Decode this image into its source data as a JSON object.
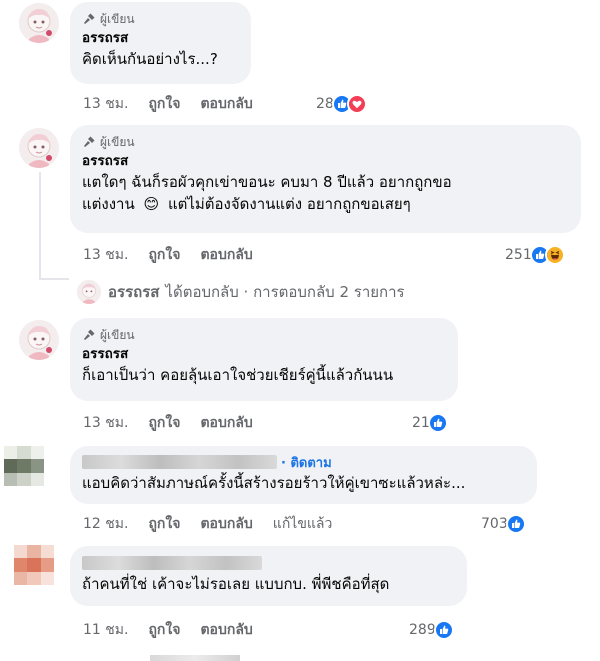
{
  "comments": [
    {
      "badge": "ผู้เขียน",
      "author": "อรรถรส",
      "lines": [
        "คิดเห็นกันอย่างไร...?"
      ],
      "time": "13 ชม.",
      "like": "ถูกใจ",
      "reply": "ตอบกลับ",
      "reaction_count": "28",
      "reactions": [
        "like",
        "love"
      ]
    },
    {
      "badge": "ผู้เขียน",
      "author": "อรรถรส",
      "lines": [
        "แตใดๆ ฉันก็รอผัวคุกเข่าขอนะ คบมา 8 ปีแล้ว อยากถูกขอ",
        "แต่งงาน",
        "แต่ไม่ต้องจัดงานแต่ง อยากถูกขอเสยๆ"
      ],
      "emoji": "😊",
      "time": "13 ชม.",
      "like": "ถูกใจ",
      "reply": "ตอบกลับ",
      "reaction_count": "251",
      "reactions": [
        "like",
        "haha"
      ]
    },
    {
      "badge": "ผู้เขียน",
      "author": "อรรถรส",
      "lines": [
        "ก็เอาเป็นว่า คอยลุ้นเอาใจช่วยเชียร์คู่นี้แล้วกันนน"
      ],
      "time": "13 ชม.",
      "like": "ถูกใจ",
      "reply": "ตอบกลับ",
      "reaction_count": "21",
      "reactions": [
        "like"
      ]
    },
    {
      "follow": "· ติดตาม",
      "lines": [
        "แอบคิดว่าสัมภาษณ์ครั้งนี้สร้างรอยร้าวให้คู่เขาซะแล้วหล่ะ..."
      ],
      "time": "12 ชม.",
      "like": "ถูกใจ",
      "reply": "ตอบกลับ",
      "edited": "แก้ไขแล้ว",
      "reaction_count": "703",
      "reactions": [
        "like"
      ]
    },
    {
      "lines": [
        "ถ้าคนที่ใช่ เค้าจะไม่รอเลย แบบกบ. พี่พีชคือที่สุด"
      ],
      "time": "11 ชม.",
      "like": "ถูกใจ",
      "reply": "ตอบกลับ",
      "reaction_count": "289",
      "reactions": [
        "like"
      ]
    }
  ],
  "reply_summary": {
    "author": "อรรถรส",
    "text": "ได้ตอบกลับ · การตอบกลับ 2 รายการ"
  },
  "colors": {
    "bubble": "#f0f2f5",
    "meta": "#65676b",
    "follow": "#1b74e4",
    "like": "#1877f2",
    "love": "#f33e58"
  }
}
